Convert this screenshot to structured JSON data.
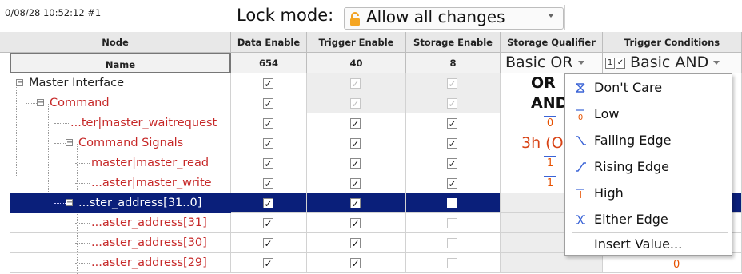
{
  "timestamp": "0/08/28 10:52:12 #1",
  "lock_mode": {
    "label": "Lock mode:",
    "value": "Allow all changes"
  },
  "columns": {
    "node": "Node",
    "data_enable": "Data Enable",
    "trigger_enable": "Trigger Enable",
    "storage_enable": "Storage Enable",
    "storage_qualifier": "Storage Qualifier",
    "trigger_conditions": "Trigger Conditions"
  },
  "subheader": {
    "name": "Name",
    "data_enable": "654",
    "trigger_enable": "40",
    "storage_enable": "8",
    "storage_qualifier": "Basic OR",
    "trigger_num": "1",
    "trigger_check": "✓",
    "trigger_conditions": "Basic AND"
  },
  "rows": [
    {
      "label": "Master Interface",
      "color": "#222222"
    },
    {
      "label": "Command",
      "color": "#c62828"
    },
    {
      "label": "...ter|master_waitrequest",
      "color": "#c62828"
    },
    {
      "label": "Command Signals",
      "color": "#c62828"
    },
    {
      "label": "master|master_read",
      "color": "#c62828"
    },
    {
      "label": "...aster|master_write",
      "color": "#c62828"
    },
    {
      "label": "...ster_address[31..0]",
      "color": "#ffffff"
    },
    {
      "label": "...aster_address[31]",
      "color": "#c62828"
    },
    {
      "label": "...aster_address[30]",
      "color": "#c62828"
    },
    {
      "label": "...aster_address[29]",
      "color": "#c62828"
    }
  ],
  "qualifier_values": [
    "OR",
    "AND",
    "0",
    "3h (O",
    "1",
    "1"
  ],
  "expander_symbol": "−",
  "check_mark": "✓",
  "menu": {
    "items": [
      "Don't Care",
      "Low",
      "Falling Edge",
      "Rising Edge",
      "High",
      "Either Edge"
    ],
    "insert_value": "Insert Value..."
  },
  "bottom_value": "0",
  "colors": {
    "selection": "#0a1f7a",
    "signal_red": "#c62828",
    "edge_orange": "#e65100"
  }
}
